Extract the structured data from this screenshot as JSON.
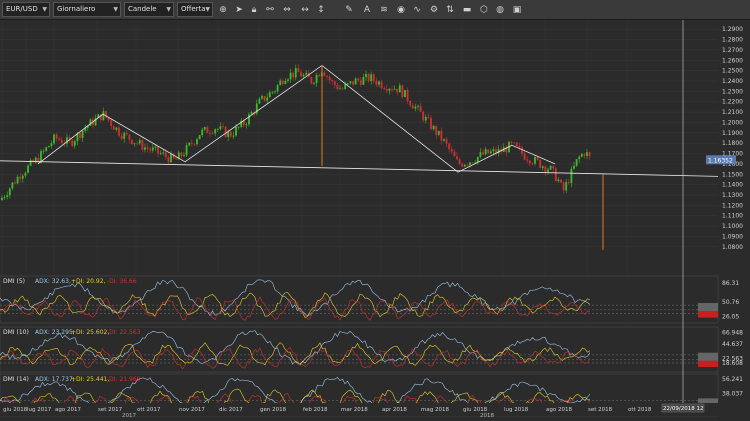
{
  "toolbar": {
    "symbol": "EUR/USD",
    "timeframe": "Giornaliero",
    "chart_type": "Candele",
    "price_type": "Offerta",
    "icons": [
      "crosshair-icon",
      "pointer-icon",
      "grid-icon",
      "lock-icon",
      "link-icon",
      "zoom-fit-icon",
      "scale-vertical-icon",
      "draw-icon",
      "text-icon",
      "layers-icon",
      "eye-icon",
      "indicator-icon",
      "settings-icon",
      "trading-icon",
      "fill-icon",
      "color-icon",
      "save-icon"
    ]
  },
  "chart_data": [
    {
      "type": "candlestick",
      "price_axis": {
        "ticks": [
          "1.2900",
          "1.2800",
          "1.2700",
          "1.2600",
          "1.2500",
          "1.2400",
          "1.2300",
          "1.2200",
          "1.2100",
          "1.2000",
          "1.1900",
          "1.1800",
          "1.1700",
          "1.1600",
          "1.1500",
          "1.1400",
          "1.1300",
          "1.1200",
          "1.1100",
          "1.1000",
          "1.0900",
          "1.0800"
        ],
        "ylim": [
          1.075,
          1.295
        ]
      },
      "current_price": "1.16352",
      "annotations": "head-and-shoulders pattern with neckline and target projections"
    },
    {
      "type": "line",
      "indicator": "DMI (5)",
      "adx_label": "ADX: 32.63,",
      "pdi_label": "+DI: 20.92,",
      "mdi_label": "-DI: 36.66",
      "axis_ticks": [
        "86.31",
        "50.76",
        "26.05"
      ]
    },
    {
      "type": "line",
      "indicator": "DMI (10)",
      "adx_label": "ADX: 23.295,",
      "pdi_label": "+DI: 25.602,",
      "mdi_label": "-DI: 22.563",
      "axis_ticks": [
        "66.948",
        "44.637",
        "22.563",
        "18.608"
      ]
    },
    {
      "type": "line",
      "indicator": "DMI (14)",
      "adx_label": "ADX: 17.737,",
      "pdi_label": "+DI: 25.441,",
      "mdi_label": "-DI: 21.969",
      "axis_ticks": [
        "56.241",
        "38.037",
        "21.969"
      ]
    }
  ],
  "time_axis": {
    "labels": [
      "giu 2018",
      "lug 2017",
      "ago 2017",
      "set 2017",
      "ott 2017",
      "nov 2017",
      "dic 2017",
      "gen 2018",
      "feb 2018",
      "mar 2018",
      "apr 2018",
      "mag 2018",
      "giu 2018",
      "lug 2018",
      "ago 2018",
      "set 2018",
      "ott 2018"
    ],
    "years": [
      "2017",
      "2018"
    ],
    "cursor_time": "22/09/2018 12"
  },
  "colors": {
    "bull": "#3cbc28",
    "bear": "#d23030",
    "adx": "#9cc8e8",
    "pdi": "#e8d028",
    "mdi": "#d23030",
    "pattern": "#e8e8e8",
    "projection": "#e07820"
  }
}
